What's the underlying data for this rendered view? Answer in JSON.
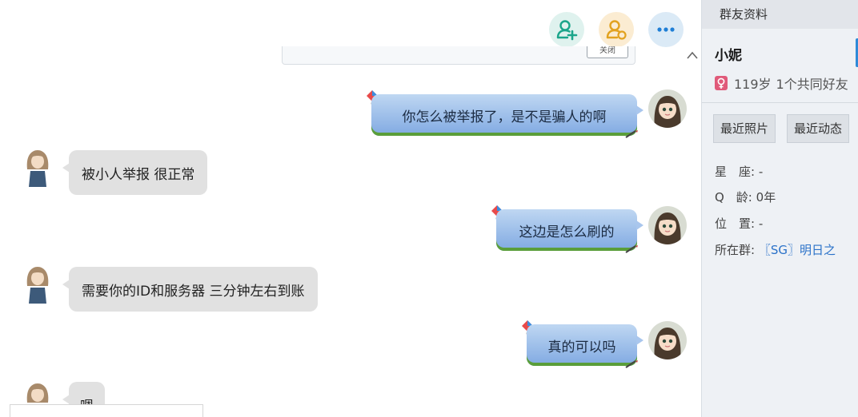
{
  "header": {
    "add_member_icon": "person-plus-icon",
    "friend_icon": "person-friend-icon",
    "more_icon": "more-dots-icon"
  },
  "preview_box_text": "关闭",
  "messages": [
    {
      "side": "right",
      "text": "你怎么被举报了，是不是骗人的啊"
    },
    {
      "side": "left",
      "text": "被小人举报 很正常"
    },
    {
      "side": "right",
      "text": "这边是怎么刷的"
    },
    {
      "side": "left",
      "text": "需要你的ID和服务器 三分钟左右到账"
    },
    {
      "side": "right",
      "text": "真的可以吗"
    },
    {
      "side": "left",
      "text": "嗯"
    }
  ],
  "panel": {
    "title": "群友资料",
    "name": "小妮",
    "age": "119岁",
    "mutual": "1个共同好友",
    "tabs": [
      "最近照片",
      "最近动态"
    ],
    "rows": [
      {
        "label": "星　座:",
        "value": "-"
      },
      {
        "label": "Q　龄:",
        "value": "0年"
      },
      {
        "label": "位　置:",
        "value": "-"
      },
      {
        "label": "所在群:",
        "value": "〖SG〗明日之"
      }
    ]
  },
  "colors": {
    "bubble_right": "#9ebee8",
    "bubble_left": "#e1e1e1",
    "accent": "#2e8ad8",
    "female": "#e05a7a"
  }
}
